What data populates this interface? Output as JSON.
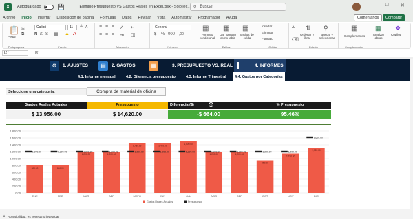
{
  "titlebar": {
    "autosave_label": "Autoguardado",
    "doc_title": "Ejemplo Presupuesto VS Gastos Reales en Excel.xlsx  -  Solo lec...",
    "search_placeholder": "Buscar"
  },
  "menu": [
    "Archivo",
    "Inicio",
    "Insertar",
    "Disposición de página",
    "Fórmulas",
    "Datos",
    "Revisar",
    "Vista",
    "Automatizar",
    "Programador",
    "Ayuda"
  ],
  "menu_active": "Inicio",
  "actions": {
    "comments": "Comentarios",
    "share": "Compartir"
  },
  "ribbon": {
    "groups": [
      "Portapapeles",
      "Fuente",
      "Alineación",
      "Número",
      "Estilos",
      "Celdas",
      "Edición",
      "Complementos"
    ],
    "paste": "Pegar",
    "font_name": "Calibri",
    "font_size": "11",
    "number_format": "General",
    "cond_format": "Formato condicional",
    "format_table": "Dar formato como tabla",
    "cell_styles": "Estilos de celda",
    "insert": "Insertar",
    "delete": "Eliminar",
    "format": "Formato",
    "sort": "Ordenar y filtrar",
    "find": "Buscar y seleccionar",
    "addins": "Complementos",
    "analyze": "Analizar datos",
    "copilot": "Copilot"
  },
  "formula": {
    "cell": "I27",
    "fx": "fx"
  },
  "nav": [
    {
      "label": "1. AJUSTES",
      "icon": "gear-icon"
    },
    {
      "label": "2. GASTOS",
      "icon": "receipt-icon"
    },
    {
      "label": "3. PRESUPUESTO VS. REAL",
      "icon": "calculator-icon"
    },
    {
      "label": "4. INFORMES",
      "icon": "bar-chart-icon"
    }
  ],
  "subtabs": [
    "4.1. Informe mensual",
    "4.2. Diferencia presupuesto",
    "4.3. Informe Trimestral",
    "4.4. Gastos por Categorías"
  ],
  "category": {
    "label": "Seleccione una categoría:",
    "value": "Compra de material de oficina"
  },
  "kpis": {
    "real_label": "Gastos Reales Actuales",
    "real_value": "$ 13,956.00",
    "budget_label": "Presupuesto",
    "budget_value": "$ 14,620.00",
    "diff_label": "Diferencia ($)",
    "diff_value": "-$ 664.00",
    "pct_label": "% Presupuesto",
    "pct_value": "95.46%"
  },
  "colors": {
    "navy": "#081b33",
    "bar": "#ef5a47",
    "budget_marker": "#222222",
    "kpi_yellow": "#f5b800",
    "kpi_green": "#47ab3a"
  },
  "chart_data": {
    "type": "bar",
    "categories": [
      "ENE",
      "FEB",
      "MAR",
      "ABR",
      "MAYO",
      "JUN",
      "JUL",
      "AGO",
      "SEP",
      "OCT",
      "NOV",
      "DIC"
    ],
    "series": [
      {
        "name": "Gastos Reales Actuales",
        "values": [
          800,
          800,
          1200,
          1200,
          1450,
          1450,
          1500,
          1200,
          1200,
          950,
          1150,
          1320
        ]
      },
      {
        "name": "Presupuesto",
        "values": [
          1200,
          1200,
          1200,
          1200,
          1200,
          1200,
          1200,
          1200,
          1200,
          1200,
          1200,
          1620
        ]
      }
    ],
    "bar_labels": [
      "800.00",
      "800.00",
      "1,200.00",
      "1,200.00",
      "1,450.00",
      "1,450.00",
      "1,500.00",
      "1,200.00",
      "1,200.00",
      "950.00",
      "1,150.00",
      "1,320.00"
    ],
    "budget_labels": [
      "1,200.00",
      "1,200.00",
      "1,200.00",
      "1,200.00",
      "1,200.00",
      "1,200.00",
      "1,200.00",
      "1,200.00",
      "1,200.00",
      "1,200.00",
      "1,200.00",
      "1,620.00"
    ],
    "ylim": [
      0,
      1800
    ],
    "yticks": [
      "0.00",
      "200.00",
      "400.00",
      "600.00",
      "800.00",
      "1,000.00",
      "1,200.00",
      "1,400.00",
      "1,600.00",
      "1,800.00"
    ],
    "grid": true,
    "legend_position": "bottom"
  },
  "status": {
    "accessibility": "Accesibilidad: es necesario investigar"
  }
}
